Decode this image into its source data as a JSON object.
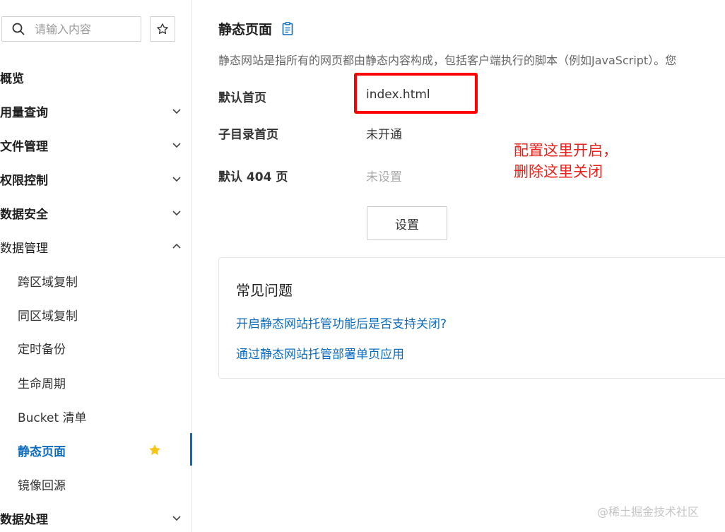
{
  "sidebar": {
    "search_placeholder": "请输入内容",
    "items": [
      {
        "label": "概览",
        "expandable": false
      },
      {
        "label": "用量查询",
        "expandable": true
      },
      {
        "label": "文件管理",
        "expandable": true
      },
      {
        "label": "权限控制",
        "expandable": true
      },
      {
        "label": "数据安全",
        "expandable": true
      },
      {
        "label": "数据管理",
        "expandable": true,
        "expanded": true
      },
      {
        "label": "跨区域复制"
      },
      {
        "label": "同区域复制"
      },
      {
        "label": "定时备份"
      },
      {
        "label": "生命周期"
      },
      {
        "label": "Bucket 清单"
      },
      {
        "label": "静态页面",
        "active": true,
        "favorited": true
      },
      {
        "label": "镜像回源"
      },
      {
        "label": "数据处理",
        "expandable": true
      }
    ]
  },
  "main": {
    "title": "静态页面",
    "description": "静态网站是指所有的网页都由静态内容构成，包括客户端执行的脚本（例如JavaScript）。您",
    "rows": [
      {
        "label": "默认首页",
        "value": "index.html"
      },
      {
        "label": "子目录首页",
        "value": "未开通"
      },
      {
        "label": "默认 404 页",
        "value": "未设置"
      }
    ],
    "annotation_line1": "配置这里开启，",
    "annotation_line2": "删除这里关闭",
    "set_button": "设置",
    "faq": {
      "title": "常见问题",
      "links": [
        "开启静态网站托管功能后是否支持关闭?",
        "通过静态网站托管部署单页应用"
      ]
    }
  },
  "watermark": "@稀土掘金技术社区",
  "colors": {
    "accent": "#0d6bbd",
    "highlight": "#ff0000",
    "annotation": "#e8231b",
    "star": "#f5c518"
  }
}
